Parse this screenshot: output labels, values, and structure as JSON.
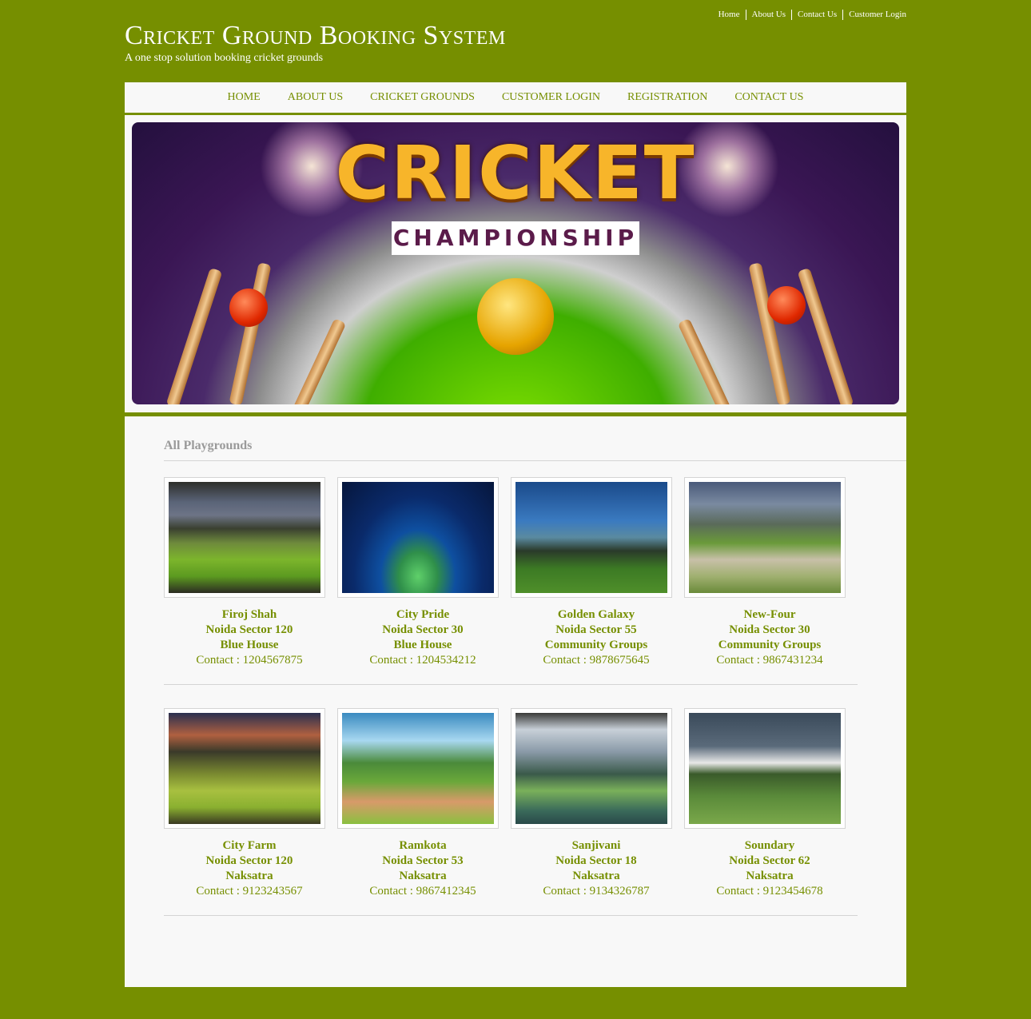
{
  "header": {
    "title": "Cricket Ground Booking System",
    "tagline": "A one stop solution booking cricket grounds",
    "top_links": [
      "Home",
      "About Us",
      "Contact Us",
      "Customer Login"
    ]
  },
  "nav": {
    "items": [
      "HOME",
      "ABOUT US",
      "CRICKET GROUNDS",
      "CUSTOMER LOGIN",
      "REGISTRATION",
      "CONTACT US"
    ]
  },
  "banner": {
    "headline": "CRICKET",
    "subheadline": "CHAMPIONSHIP"
  },
  "colors": {
    "brand": "#768f00",
    "panel": "#f8f8f8",
    "muted_text": "#9a9a9a"
  },
  "playgrounds": {
    "title": "All Playgrounds",
    "contact_label": "Contact : ",
    "rows": [
      [
        {
          "name": "Firoj Shah",
          "location": "Noida Sector 120",
          "group": "Blue House",
          "contact": "1204567875",
          "image": "floodlit-stadium-photo"
        },
        {
          "name": "City Pride",
          "location": "Noida Sector 30",
          "group": "Blue House",
          "contact": "1204534212",
          "image": "night-stadium-illustration"
        },
        {
          "name": "Golden Galaxy",
          "location": "Noida Sector 55",
          "group": "Community Groups",
          "contact": "9878675645",
          "image": "stadium-evening-photo"
        },
        {
          "name": "New-Four",
          "location": "Noida Sector 30",
          "group": "Community Groups",
          "contact": "9867431234",
          "image": "pitch-wickets-photo"
        }
      ],
      [
        {
          "name": "City Farm",
          "location": "Noida Sector 120",
          "group": "Naksatra",
          "contact": "9123243567",
          "image": "sunset-stadium-photo"
        },
        {
          "name": "Ramkota",
          "location": "Noida Sector 53",
          "group": "Naksatra",
          "contact": "9867412345",
          "image": "stadium-pitch-illustration"
        },
        {
          "name": "Sanjivani",
          "location": "Noida Sector 18",
          "group": "Naksatra",
          "contact": "9134326787",
          "image": "stadium-day-photo"
        },
        {
          "name": "Soundary",
          "location": "Noida Sector 62",
          "group": "Naksatra",
          "contact": "9123454678",
          "image": "pavilion-ground-photo"
        }
      ]
    ]
  }
}
